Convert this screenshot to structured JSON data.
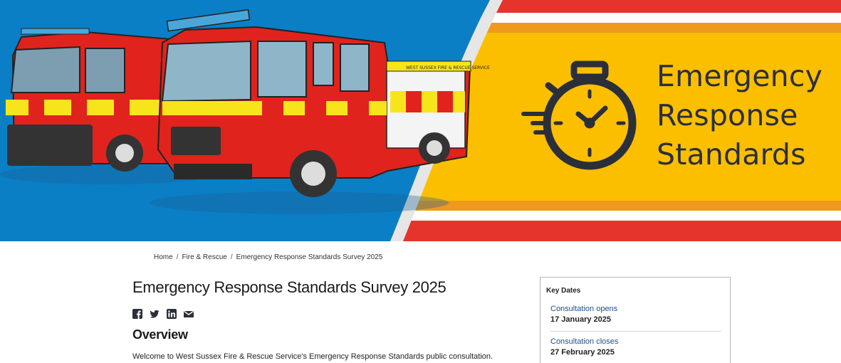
{
  "banner": {
    "title_lines": [
      "Emergency",
      "Response",
      "Standards"
    ],
    "colors": {
      "sky": "#0a7fc6",
      "yellow": "#fbbf00",
      "orange": "#ef9a1c",
      "red": "#e5342b",
      "truck_red": "#e0231c",
      "icon_dark": "#2b2f3a"
    },
    "truck_signage": "WEST SUSSEX FIRE & RESCUE SERVICE"
  },
  "breadcrumb": {
    "items": [
      "Home",
      "Fire & Rescue",
      "Emergency Response Standards Survey 2025"
    ],
    "separator": "/"
  },
  "page": {
    "title": "Emergency Response Standards Survey 2025",
    "overview_heading": "Overview",
    "intro": "Welcome to West Sussex Fire & Rescue Service's Emergency Response Standards public consultation."
  },
  "share": {
    "icons": [
      "facebook-icon",
      "twitter-icon",
      "linkedin-icon",
      "email-icon"
    ]
  },
  "key_dates": {
    "heading": "Key Dates",
    "items": [
      {
        "label": "Consultation opens",
        "value": "17 January 2025"
      },
      {
        "label": "Consultation closes",
        "value": "27 February 2025"
      }
    ]
  }
}
